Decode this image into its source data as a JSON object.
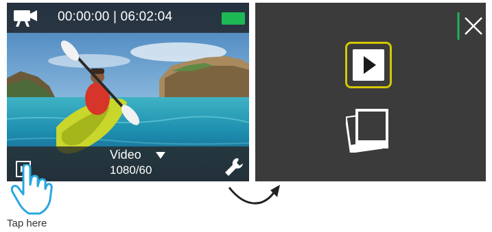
{
  "status": {
    "timecode": "00:00:00 | 06:02:04",
    "mode_icon": "video-camera-icon",
    "battery_icon": "battery-full-icon"
  },
  "bottom_bar": {
    "mode_label": "Video",
    "resolution": "1080/60",
    "playback_icon": "play-square-icon",
    "settings_icon": "wrench-icon",
    "dropdown_icon": "caret-down-icon"
  },
  "hint": {
    "label": "Tap here",
    "hand_icon": "pointing-hand-icon",
    "arrow_icon": "curved-arrow-icon"
  },
  "playback_menu": {
    "close_icon": "close-icon",
    "video_playback_icon": "play-icon",
    "photo_playback_icon": "photo-stack-icon"
  },
  "colors": {
    "status_overlay": "#1e1e1e",
    "battery": "#1db954",
    "accent_green": "#1fb35a",
    "highlight_border": "#d4c800",
    "menu_background": "#3b3b3b",
    "hand_outline": "#2aa7e0"
  }
}
